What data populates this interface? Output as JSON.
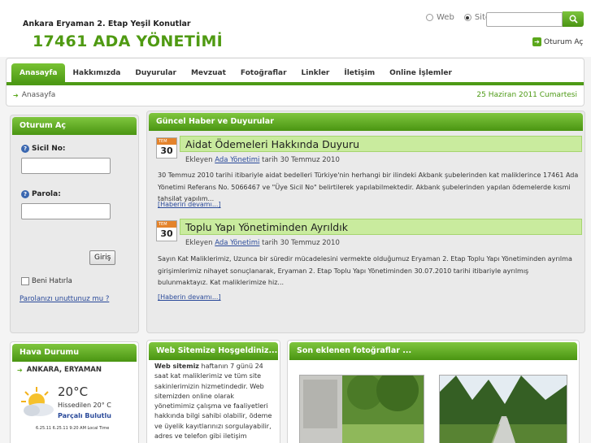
{
  "header": {
    "subtitle": "Ankara Eryaman 2. Etap Yeşil Konutlar",
    "title": "17461 ADA YÖNETİMİ",
    "search_web": "Web",
    "search_site": "Site",
    "login_link": "Oturum Aç"
  },
  "nav": {
    "items": [
      "Anasayfa",
      "Hakkımızda",
      "Duyurular",
      "Mevzuat",
      "Fotoğraflar",
      "Linkler",
      "İletişim",
      "Online İşlemler"
    ],
    "breadcrumb": "Anasayfa",
    "date": "25 Haziran 2011 Cumartesi"
  },
  "login": {
    "title": "Oturum Aç",
    "user_label": "Sicil No:",
    "pass_label": "Parola:",
    "submit": "Giriş",
    "remember": "Beni Hatırla",
    "forgot": "Parolanızı unuttunuz mu ?"
  },
  "weather": {
    "title": "Hava Durumu",
    "location": "ANKARA, ERYAMAN",
    "temp": "20°C",
    "feels": "Hissedilen 20° C",
    "condition": "Parçalı Bulutlu",
    "timestamp": "6.25.11 6.25.11 9:20 AM Local Time"
  },
  "news": {
    "title": "Güncel Haber ve Duyurular",
    "items": [
      {
        "month": "TEM",
        "day": "30",
        "headline": "Aidat Ödemeleri Hakkında Duyuru",
        "by_prefix": "Ekleyen",
        "author": "Ada Yönetimi",
        "date_text": "tarih 30 Temmuz 2010",
        "body": "30 Temmuz 2010 tarihi itibariyle aidat bedelleri Türkiye'nin herhangi bir ilindeki Akbank şubelerinden kat maliklerince 17461 Ada Yönetimi Referans No. 5066467 ve \"Üye Sicil No\" belirtilerek yapılabilmektedir. Akbank şubelerinden yapılan ödemelerde kısmi tahsilat yapılım...",
        "more": "[Haberin devamı...]"
      },
      {
        "month": "TEM",
        "day": "30",
        "headline": "Toplu Yapı Yönetiminden Ayrıldık",
        "by_prefix": "Ekleyen",
        "author": "Ada Yönetimi",
        "date_text": "tarih 30 Temmuz 2010",
        "body": "Sayın Kat Maliklerimiz, Uzunca bir süredir mücadelesini vermekte olduğumuz Eryaman 2. Etap Toplu Yapı Yönetiminden ayrılma girişimlerimiz nihayet sonuçlanarak, Eryaman 2. Etap Toplu Yapı Yönetiminden 30.07.2010 tarihi itibariyle ayrılmış bulunmaktayız. Kat maliklerimize hiz...",
        "more": "[Haberin devamı...]"
      }
    ]
  },
  "welcome": {
    "title": "Web Sitemize Hoşgeldiniz...",
    "bold": "Web sitemiz",
    "text": " haftanın 7 günü 24 saat kat maliklerimiz ve tüm site sakinlerimizin hizmetindedir. Web sitemizden online olarak yönetimimiz çalışma ve faaliyetleri hakkında bilgi sahibi olabilir, ödeme ve üyelik kayıtlarınızı sorgulayabilir, adres ve telefon gibi iletişim bilgilerinizdeki"
  },
  "photos": {
    "title": "Son eklenen fotoğraflar ..."
  }
}
